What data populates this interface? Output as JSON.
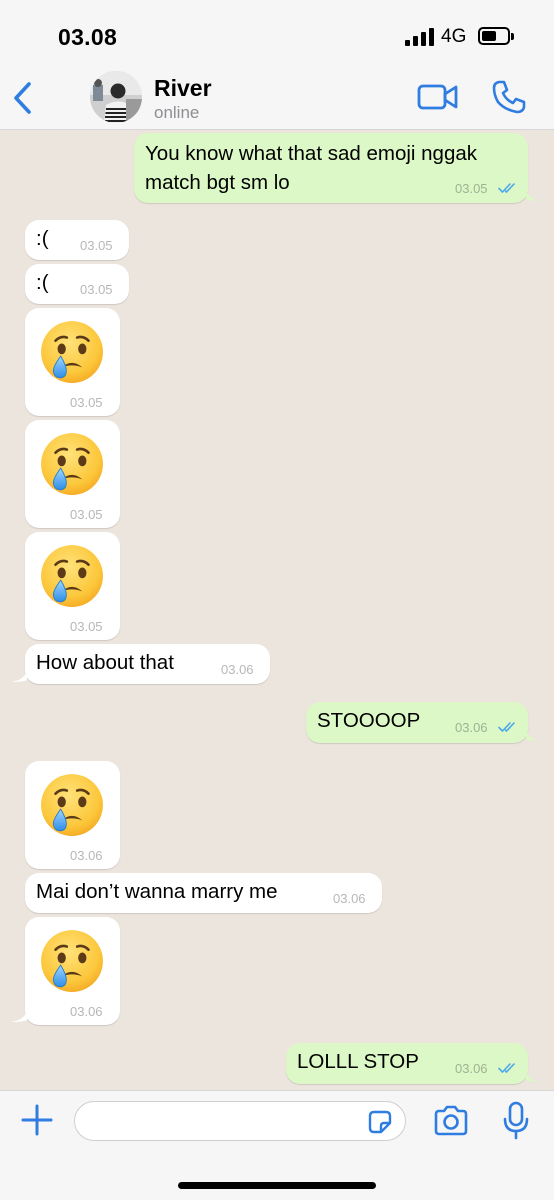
{
  "status_bar": {
    "time": "03.08",
    "network": "4G"
  },
  "header": {
    "contact_name": "River",
    "contact_status": "online"
  },
  "messages": [
    {
      "direction": "out",
      "text_lines": [
        "You know what that sad emoji nggak",
        "match bgt sm lo"
      ],
      "time": "03.05",
      "read": true
    },
    {
      "direction": "in",
      "text": ":(",
      "time": "03.05"
    },
    {
      "direction": "in",
      "text": ":(",
      "time": "03.05"
    },
    {
      "direction": "in",
      "emoji": "crying-face",
      "time": "03.05"
    },
    {
      "direction": "in",
      "emoji": "crying-face",
      "time": "03.05"
    },
    {
      "direction": "in",
      "emoji": "crying-face",
      "time": "03.05"
    },
    {
      "direction": "in",
      "text": "How about that",
      "time": "03.06"
    },
    {
      "direction": "out",
      "text": "STOOOOP",
      "time": "03.06",
      "read": true
    },
    {
      "direction": "in",
      "emoji": "crying-face",
      "time": "03.06"
    },
    {
      "direction": "in",
      "text": "Mai don’t wanna marry me",
      "time": "03.06"
    },
    {
      "direction": "in",
      "emoji": "crying-face",
      "time": "03.06"
    },
    {
      "direction": "out",
      "text": "LOLLL STOP",
      "time": "03.06",
      "read": true
    }
  ],
  "input_bar": {
    "placeholder": ""
  },
  "colors": {
    "accent": "#2f7de1",
    "incoming_bubble": "#ffffff",
    "outgoing_bubble": "#dcf8c6",
    "chat_background": "#ece5dd",
    "read_ticks": "#4fa9e8"
  },
  "icons": [
    "back-chevron-icon",
    "video-call-icon",
    "phone-icon",
    "plus-icon",
    "sticker-icon",
    "camera-icon",
    "microphone-icon",
    "crying-face-emoji",
    "double-check-icon"
  ]
}
